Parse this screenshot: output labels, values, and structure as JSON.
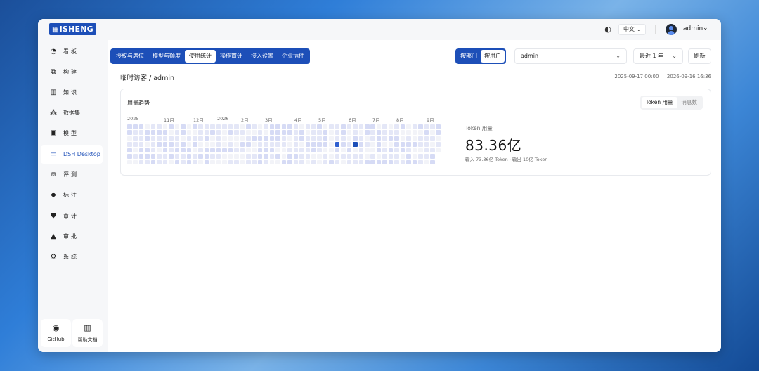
{
  "app": {
    "logo_glyph": "▦",
    "logo_text": "ISHENG"
  },
  "header": {
    "language": "中文",
    "username": "admin"
  },
  "sidebar": {
    "items": [
      {
        "label": "看板",
        "icon": "dashboard-icon"
      },
      {
        "label": "构建",
        "icon": "build-icon"
      },
      {
        "label": "知识",
        "icon": "book-icon"
      },
      {
        "label": "数据集",
        "icon": "dataset-icon"
      },
      {
        "label": "模型",
        "icon": "model-icon"
      },
      {
        "label": "DSH Desktop",
        "icon": "desktop-icon",
        "active": true
      },
      {
        "label": "评测",
        "icon": "evaluation-icon"
      },
      {
        "label": "标注",
        "icon": "tag-icon"
      },
      {
        "label": "审计",
        "icon": "shield-icon"
      },
      {
        "label": "审批",
        "icon": "stamp-icon"
      },
      {
        "label": "系统",
        "icon": "gear-icon"
      }
    ],
    "footer": [
      {
        "label": "GitHub",
        "icon": "github-icon"
      },
      {
        "label": "帮助文档",
        "icon": "help-book-icon"
      }
    ]
  },
  "toolbar": {
    "tabs": [
      "授权与席位",
      "模型与额度",
      "使用统计",
      "操作审计",
      "接入设置",
      "企业插件"
    ],
    "active_tab": "使用统计",
    "group_by": [
      "按部门",
      "按用户"
    ],
    "active_group": "按用户",
    "user_select": "admin",
    "range_select": "最近 1 年",
    "refresh_label": "刷新"
  },
  "breadcrumb": "临时访客 / admin",
  "date_range": "2025-09-17 00:00 — 2026-09-16 16:36",
  "usage_card": {
    "title": "用量趋势",
    "metric_options": [
      "Token 用量",
      "消息数"
    ],
    "active_metric": "Token 用量",
    "month_labels": [
      "2025",
      "11月",
      "12月",
      "2026",
      "2月",
      "3月",
      "4月",
      "5月",
      "6月",
      "7月",
      "8月",
      "9月"
    ],
    "stat_label": "Token 用量",
    "stat_value": "83.36亿",
    "stat_sub": "输入 73.36亿 Token · 输出 10亿 Token",
    "colors": {
      "empty": "#f2f3f8",
      "low": "#e4e7f7",
      "mid": "#d6dbf5",
      "high": "#2f5fd0",
      "peak": "#1d4fb8"
    }
  }
}
